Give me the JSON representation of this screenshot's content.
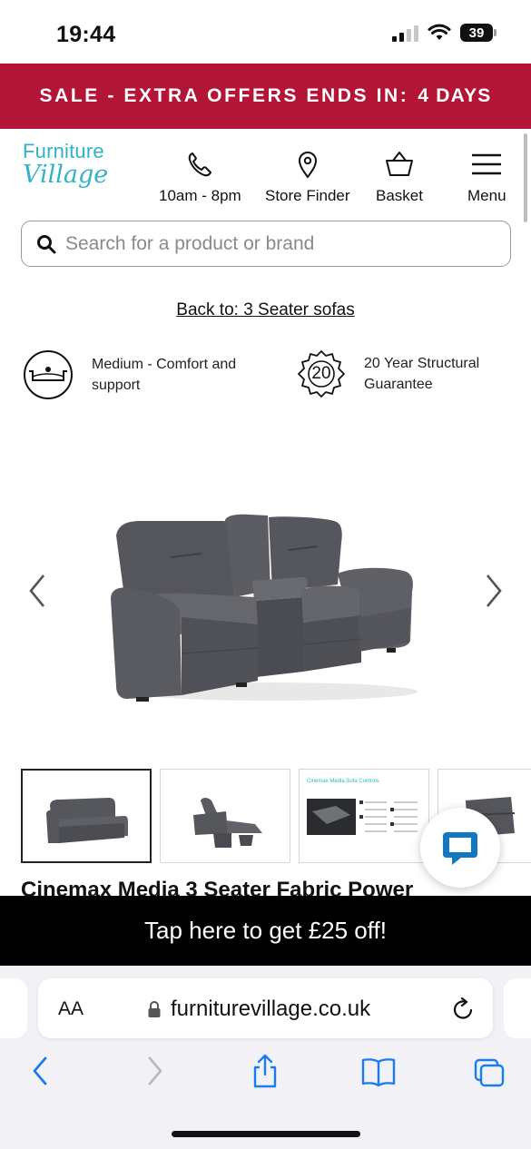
{
  "status_bar": {
    "time": "19:44",
    "battery": "39"
  },
  "sale_banner": {
    "text": "SALE - EXTRA OFFERS ENDS IN:",
    "countdown": "4 DAYS",
    "color": "#b31537"
  },
  "header": {
    "logo_line1": "Furniture",
    "logo_line2": "Village",
    "nav": [
      {
        "label": "10am - 8pm",
        "icon": "phone-icon"
      },
      {
        "label": "Store Finder",
        "icon": "location-pin-icon"
      },
      {
        "label": "Basket",
        "icon": "basket-icon"
      },
      {
        "label": "Menu",
        "icon": "hamburger-menu-icon"
      }
    ]
  },
  "search": {
    "placeholder": "Search for a product or brand",
    "value": ""
  },
  "breadcrumb": {
    "back_link": "Back to: 3 Seater sofas"
  },
  "features": [
    {
      "icon": "comfort-level-icon",
      "text": "Medium - Comfort and support"
    },
    {
      "icon": "guarantee-badge-icon",
      "badge": "20",
      "text": "20 Year Structural Guarantee"
    }
  ],
  "gallery": {
    "prev_icon": "chevron-left-icon",
    "next_icon": "chevron-right-icon"
  },
  "thumbnails": [
    {
      "name": "sofa-front-view"
    },
    {
      "name": "sofa-reclined-view"
    },
    {
      "name": "controls-spec-sheet",
      "caption": "Cinemax Media Sofa Controls"
    },
    {
      "name": "sofa-detail-view"
    }
  ],
  "product": {
    "title": "Cinemax Media 3 Seater Fabric Power"
  },
  "promo": {
    "text": "Tap here to get £25 off!"
  },
  "browser": {
    "aa": "AA",
    "url": "furniturevillage.co.uk"
  }
}
